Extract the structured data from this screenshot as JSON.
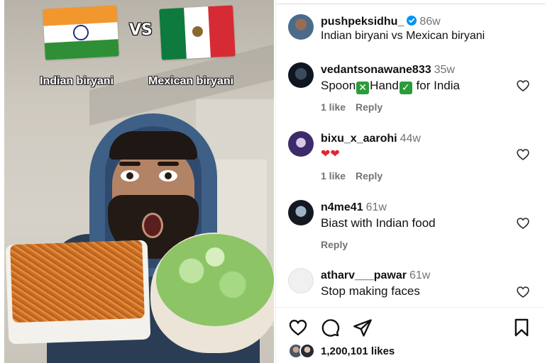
{
  "video": {
    "caption_left": "Indian biryani",
    "caption_vs": "VS",
    "caption_right": "Mexican biryani"
  },
  "post": {
    "author": {
      "username": "pushpeksidhu_",
      "time": "86w",
      "verified": true,
      "caption": "Indian biryani vs Mexican biryani"
    },
    "comments": [
      {
        "username": "vedantsonawane833",
        "time": "35w",
        "text_before": "Spoon",
        "emoji_1": "✕",
        "text_mid": "Hand",
        "emoji_2": "✓",
        "text_after": " for India",
        "likes": "1 like",
        "reply": "Reply"
      },
      {
        "username": "bixu_x_aarohi",
        "time": "44w",
        "text": "❤❤",
        "likes": "1 like",
        "reply": "Reply"
      },
      {
        "username": "n4me41",
        "time": "61w",
        "text": "Biast with Indian food",
        "reply": "Reply"
      },
      {
        "username": "atharv___pawar",
        "time": "61w",
        "text": "Stop making faces"
      }
    ],
    "likes_count": "1,200,101 likes"
  },
  "colors": {
    "verified_blue": "#0095f6",
    "muted_text": "#737373",
    "heart_red": "#e0262f"
  },
  "icons": {
    "like": "heart-icon",
    "comment": "comment-icon",
    "share": "send-icon",
    "save": "bookmark-icon",
    "verified": "verified-badge-icon"
  }
}
